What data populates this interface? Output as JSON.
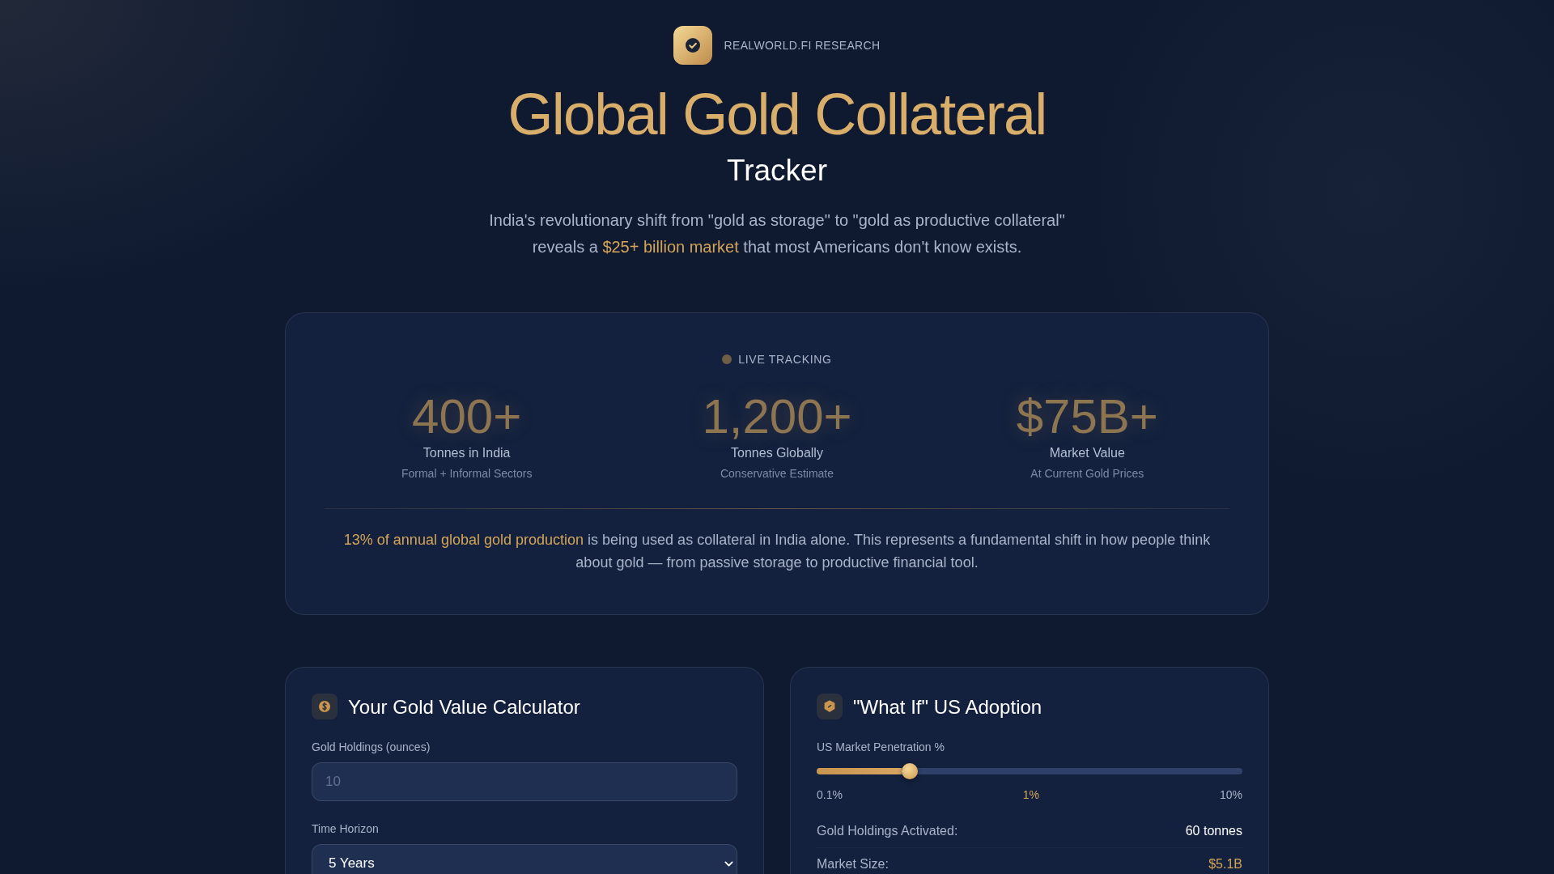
{
  "brand": {
    "name": "REALWORLD.FI RESEARCH"
  },
  "hero": {
    "title": "Global Gold Collateral",
    "subtitle": "Tracker",
    "description": [
      {
        "text": "India's revolutionary shift from \"gold as storage\" to \"gold as productive collateral\" reveals a ",
        "highlighted": false
      },
      {
        "text": "$25+ billion market",
        "highlighted": true
      },
      {
        "text": " that most Americans don't know exists.",
        "highlighted": false
      }
    ]
  },
  "tracker": {
    "status": "LIVE TRACKING",
    "stats": [
      {
        "value": "400+",
        "label": "Tonnes in India",
        "note": "Formal + Informal Sectors"
      },
      {
        "value": "1,200+",
        "label": "Tonnes Globally",
        "note": "Conservative Estimate"
      },
      {
        "value": "$75B+",
        "label": "Market Value",
        "note": "At Current Gold Prices"
      }
    ],
    "summary": [
      {
        "text": "13% of annual global gold production",
        "highlighted": true
      },
      {
        "text": " is being used as collateral in India alone. This represents a fundamental shift in how people think about gold — from passive storage to productive financial tool.",
        "highlighted": false
      }
    ]
  },
  "calculator": {
    "title": "Your Gold Value Calculator",
    "fields": [
      {
        "kind": "input",
        "label": "Gold Holdings (ounces)",
        "placeholder": "10"
      },
      {
        "kind": "select",
        "label": "Time Horizon",
        "value": "5 Years"
      }
    ]
  },
  "adoption": {
    "title": "\"What If\" US Adoption",
    "slider": {
      "label": "US Market Penetration %",
      "level": 0.2,
      "min_label": "0.1%",
      "value_label": "1%",
      "max_label": "10%"
    },
    "results": [
      {
        "label": "Gold Holdings Activated:",
        "value": "60 tonnes",
        "highlighted": false
      },
      {
        "label": "Market Size:",
        "value": "$5.1B",
        "highlighted": true
      }
    ]
  }
}
